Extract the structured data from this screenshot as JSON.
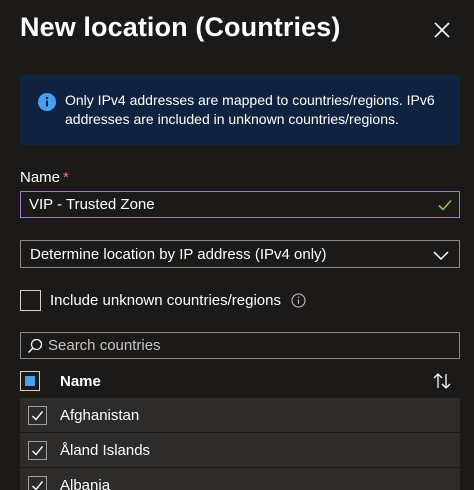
{
  "panel": {
    "title": "New location (Countries)"
  },
  "info": {
    "message": "Only IPv4 addresses are mapped to countries/regions. IPv6 addresses are included in unknown countries/regions."
  },
  "name_field": {
    "label": "Name",
    "required_marker": "*",
    "value": "VIP - Trusted Zone"
  },
  "location_method": {
    "selected": "Determine location by IP address (IPv4 only)"
  },
  "include_unknown": {
    "label": "Include unknown countries/regions",
    "checked": false
  },
  "search": {
    "placeholder": "Search countries"
  },
  "table": {
    "column_name": "Name",
    "rows": [
      {
        "name": "Afghanistan",
        "checked": true
      },
      {
        "name": "Åland Islands",
        "checked": true
      },
      {
        "name": "Albania",
        "checked": true
      }
    ]
  },
  "colors": {
    "background": "#1b1a19",
    "info_bg": "#0f2340",
    "accent": "#4aa0f0",
    "focus_border": "#a675cf",
    "valid_check": "#92c353",
    "required": "#f1707b",
    "row_bg": "#2d2c2b"
  },
  "icons": {
    "close": "close-icon",
    "info": "info-icon",
    "valid": "checkmark-icon",
    "dropdown": "chevron-down-icon",
    "search": "search-icon",
    "sort": "sort-icon",
    "row_check": "checkmark-icon"
  }
}
